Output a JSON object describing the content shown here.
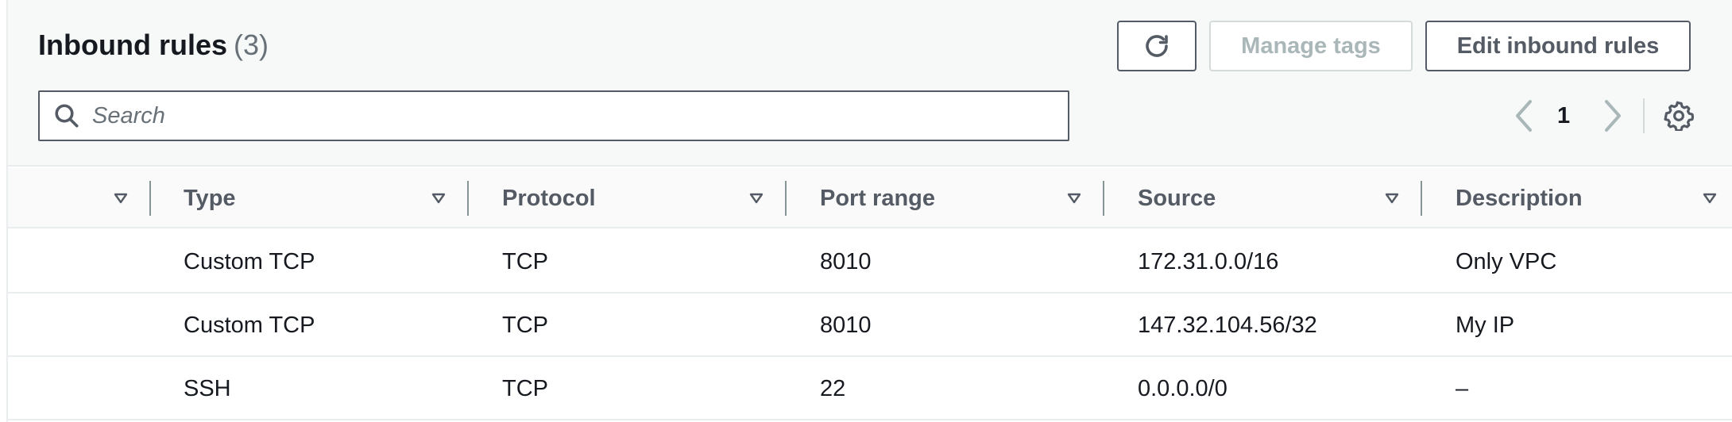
{
  "header": {
    "title": "Inbound rules",
    "count": "(3)"
  },
  "toolbar": {
    "refresh_icon": "refresh-icon",
    "manage_tags_label": "Manage tags",
    "edit_label": "Edit inbound rules"
  },
  "search": {
    "placeholder": "Search",
    "value": ""
  },
  "pagination": {
    "current_page": "1"
  },
  "icons": {
    "search": "search-icon",
    "prev": "chevron-left-icon",
    "next": "chevron-right-icon",
    "settings": "gear-icon",
    "sort": "caret-down-icon"
  },
  "table": {
    "columns": [
      "Type",
      "Protocol",
      "Port range",
      "Source",
      "Description"
    ],
    "rows": [
      {
        "type": "Custom TCP",
        "protocol": "TCP",
        "port_range": "8010",
        "source": "172.31.0.0/16",
        "description": "Only VPC"
      },
      {
        "type": "Custom TCP",
        "protocol": "TCP",
        "port_range": "8010",
        "source": "147.32.104.56/32",
        "description": "My IP"
      },
      {
        "type": "SSH",
        "protocol": "TCP",
        "port_range": "22",
        "source": "0.0.0.0/0",
        "description": "–"
      }
    ]
  },
  "colors": {
    "text": "#16191f",
    "muted": "#687078",
    "border": "#545b64",
    "disabled": "#aab7b8"
  }
}
